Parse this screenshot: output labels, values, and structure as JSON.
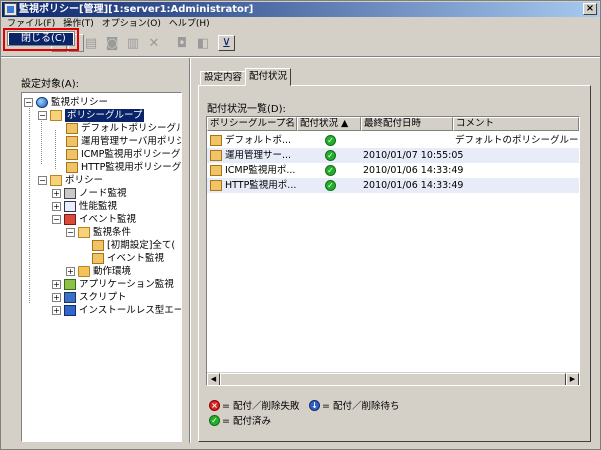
{
  "window": {
    "title": "監視ポリシー[管理][1:server1:Administrator]",
    "close": "×"
  },
  "menu": [
    "ファイル(F)",
    "操作(T)",
    "オプション(O)",
    "ヘルプ(H)"
  ],
  "popup": {
    "selected": "閉じる(C)"
  },
  "toolbar": {
    "icons": [
      "new-icon",
      "edit-icon",
      "delete-icon",
      "copy-icon",
      "cut-icon",
      "paste-icon",
      "refresh-icon"
    ],
    "active_glyph": "⊻"
  },
  "left": {
    "label": "設定対象(A):"
  },
  "tree": [
    {
      "label": "監視ポリシー",
      "icon": "globe-icon"
    },
    {
      "label": "ポリシーグループ",
      "icon": "folder-icon"
    },
    {
      "label": "デフォルトポリシーグル",
      "icon": "policy-icon"
    },
    {
      "label": "運用管理サーバ用ポリシ",
      "icon": "policy-icon"
    },
    {
      "label": "ICMP監視用ポリシーグ",
      "icon": "policy-icon"
    },
    {
      "label": "HTTP監視用ポリシーグル",
      "icon": "policy-icon"
    },
    {
      "label": "ポリシー",
      "icon": "folder-icon"
    },
    {
      "label": "ノード監視",
      "icon": "node-icon"
    },
    {
      "label": "性能監視",
      "icon": "perf-icon"
    },
    {
      "label": "イベント監視",
      "icon": "event-icon"
    },
    {
      "label": "監視条件",
      "icon": "folder-icon"
    },
    {
      "label": "[初期設定]全て(",
      "icon": "policy-icon"
    },
    {
      "label": "イベント監視",
      "icon": "policy-icon"
    },
    {
      "label": "動作環境",
      "icon": "folder-icon"
    },
    {
      "label": "アプリケーション監視",
      "icon": "app-icon"
    },
    {
      "label": "スクリプト",
      "icon": "script-icon"
    },
    {
      "label": "インストールレス型エー",
      "icon": "install-icon"
    }
  ],
  "tabs": [
    "設定内容",
    "配付状況"
  ],
  "list": {
    "label": "配付状況一覧(D):",
    "columns": [
      "ポリシーグループ名",
      "配付状況 ▲",
      "最終配付日時",
      "コメント"
    ],
    "rows": [
      {
        "name": "デフォルトポ...",
        "status": "✓",
        "date": "",
        "comment": "デフォルトのポリシーグループ"
      },
      {
        "name": "運用管理サー...",
        "status": "✓",
        "date": "2010/01/07 10:55:05",
        "comment": ""
      },
      {
        "name": "ICMP監視用ポ...",
        "status": "✓",
        "date": "2010/01/06 14:33:49",
        "comment": ""
      },
      {
        "name": "HTTP監視用ポ...",
        "status": "✓",
        "date": "2010/01/06 14:33:49",
        "comment": ""
      }
    ]
  },
  "legend": {
    "fail": "= 配付／削除失敗",
    "wait": "= 配付／削除待ち",
    "done": "= 配付済み",
    "fail_glyph": "×",
    "wait_glyph": "↓",
    "done_glyph": "✓"
  }
}
